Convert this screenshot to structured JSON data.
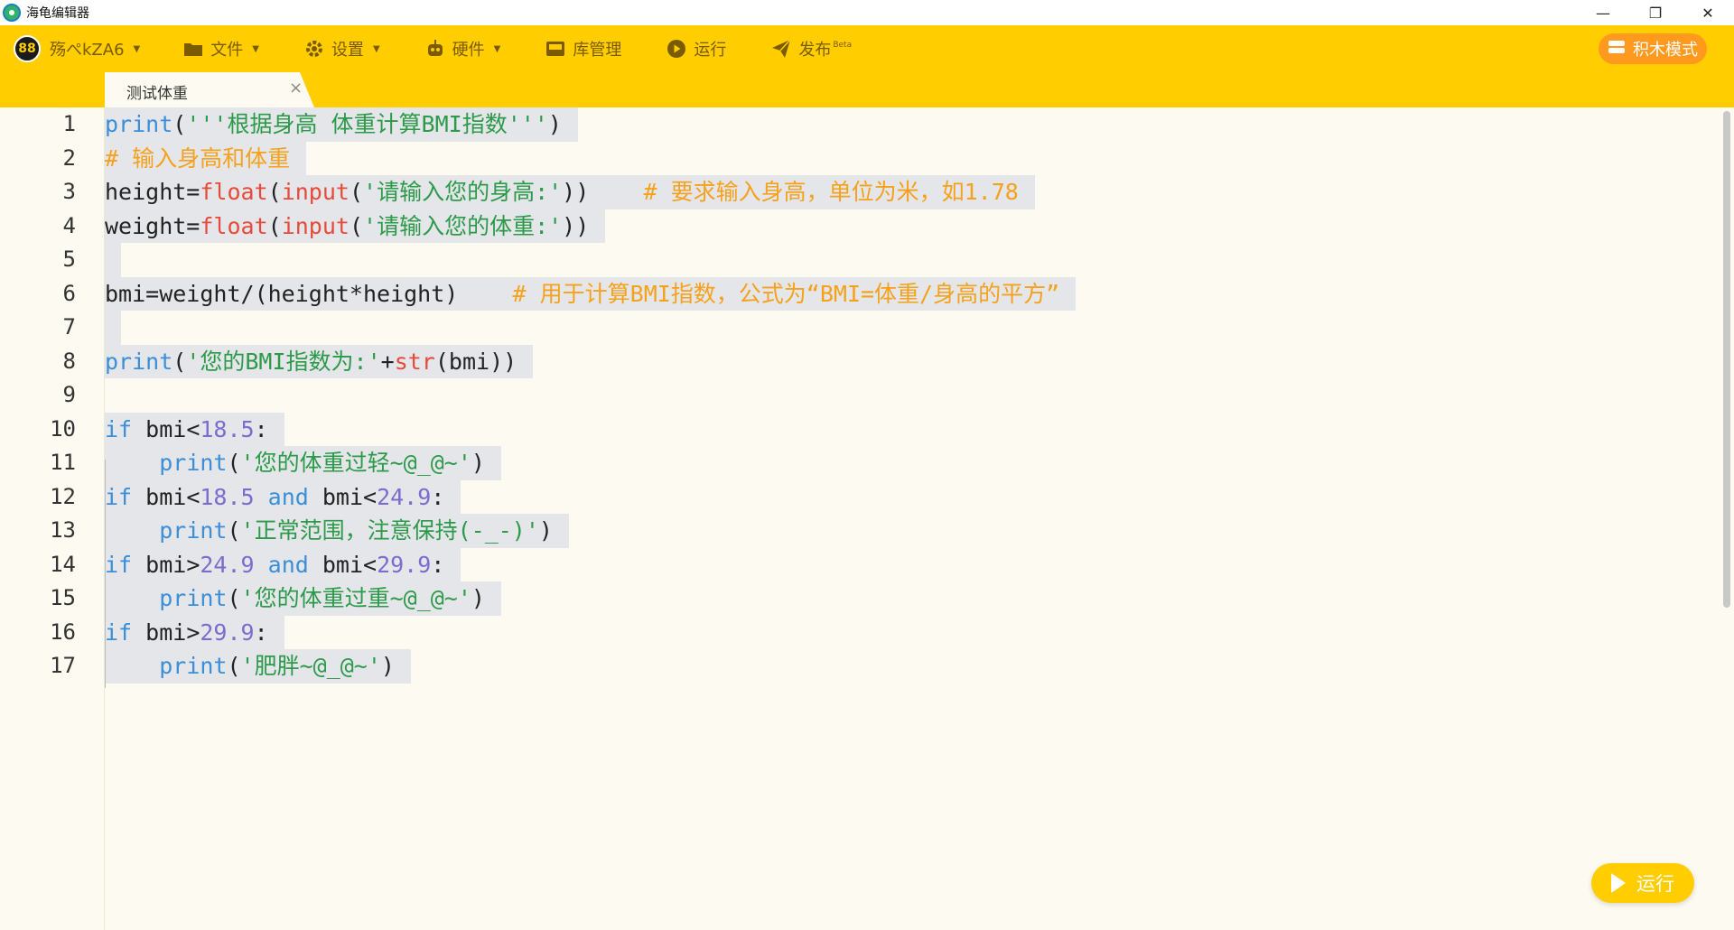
{
  "window": {
    "title": "海龟编辑器",
    "controls": {
      "minimize": "—",
      "restore": "❐",
      "close": "✕"
    }
  },
  "menubar": {
    "user": {
      "avatar_text": "88",
      "name": "殇ぺkZA6"
    },
    "items": [
      {
        "label": "文件",
        "icon": "folder-icon",
        "has_caret": true
      },
      {
        "label": "设置",
        "icon": "gear-icon",
        "has_caret": true
      },
      {
        "label": "硬件",
        "icon": "robot-icon",
        "has_caret": true
      },
      {
        "label": "库管理",
        "icon": "library-icon",
        "has_caret": false
      },
      {
        "label": "运行",
        "icon": "play-circle-icon",
        "has_caret": false
      },
      {
        "label": "发布",
        "icon": "send-icon",
        "has_caret": false,
        "badge": "Beta"
      }
    ],
    "block_mode_label": "积木模式"
  },
  "tabs": [
    {
      "label": "测试体重",
      "close": "×"
    }
  ],
  "editor": {
    "line_numbers": [
      "1",
      "2",
      "3",
      "4",
      "5",
      "6",
      "7",
      "8",
      "9",
      "10",
      "11",
      "12",
      "13",
      "14",
      "15",
      "16",
      "17"
    ],
    "colors": {
      "keyword": "#3b8ed8",
      "builtin": "#e84a3a",
      "string": "#2d9a4a",
      "comment": "#f5a11b",
      "number": "#7b6ccd"
    }
  },
  "run_button_label": "运行"
}
